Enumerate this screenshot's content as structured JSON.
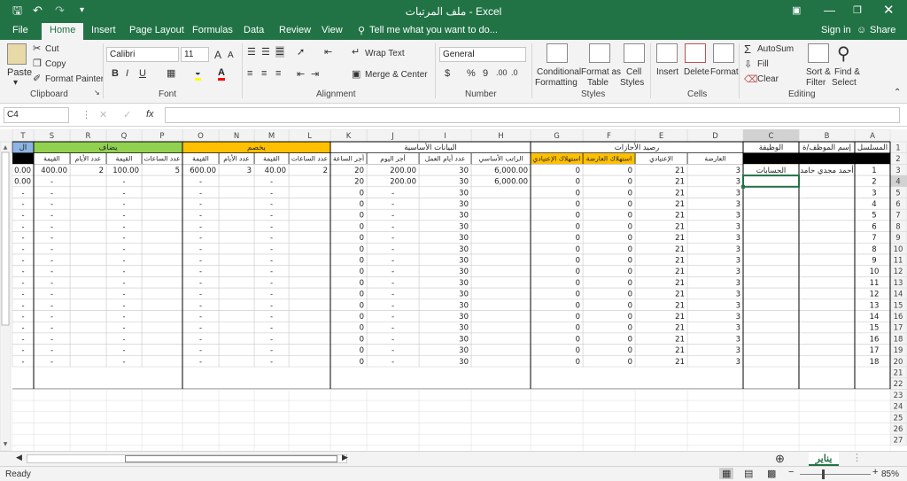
{
  "window": {
    "title": "ملف المرتبات - Excel"
  },
  "quick_access": {
    "save_icon": "save-icon",
    "undo_icon": "undo-icon",
    "redo_icon": "redo-icon"
  },
  "window_controls": {
    "minimize": "minimize-icon",
    "maximize": "restore-icon",
    "close": "close-icon"
  },
  "tabs": [
    "File",
    "Home",
    "Insert",
    "Page Layout",
    "Formulas",
    "Data",
    "Review",
    "View"
  ],
  "active_tab": "Home",
  "tell_me": "Tell me what you want to do...",
  "sign_in": "Sign in",
  "share": "Share",
  "ribbon": {
    "clipboard": {
      "paste": "Paste",
      "cut": "Cut",
      "copy": "Copy",
      "format_painter": "Format Painter",
      "label": "Clipboard"
    },
    "font": {
      "name": "Calibri",
      "size": "11",
      "bold": "B",
      "italic": "I",
      "underline": "U",
      "label": "Font"
    },
    "alignment": {
      "wrap": "Wrap Text",
      "merge": "Merge & Center",
      "label": "Alignment"
    },
    "number": {
      "format": "General",
      "currency": "$",
      "percent": "%",
      "comma": "9",
      "label": "Number"
    },
    "styles": {
      "conditional": "Conditional",
      "conditional2": "Formatting",
      "format_as": "Format as",
      "format_as2": "Table",
      "cell": "Cell",
      "cell2": "Styles",
      "label": "Styles"
    },
    "cells": {
      "insert": "Insert",
      "delete": "Delete",
      "format": "Format",
      "label": "Cells"
    },
    "editing": {
      "autosum": "AutoSum",
      "fill": "Fill",
      "clear": "Clear",
      "sort": "Sort &",
      "sort2": "Filter",
      "find": "Find &",
      "find2": "Select",
      "label": "Editing"
    }
  },
  "formula_bar": {
    "name_box": "C4",
    "fx": "fx",
    "content": ""
  },
  "accent": "#217346",
  "sheet": {
    "col_letters": [
      "A",
      "B",
      "C",
      "D",
      "E",
      "F",
      "G",
      "H",
      "I",
      "J",
      "K",
      "L",
      "M",
      "N",
      "O",
      "P",
      "Q",
      "R",
      "S",
      "T"
    ],
    "row_numbers": [
      "1",
      "2",
      "3",
      "4",
      "5",
      "6",
      "7",
      "8",
      "9",
      "10",
      "11",
      "12",
      "13",
      "14",
      "15",
      "16",
      "17",
      "18",
      "19",
      "20",
      "21",
      "22",
      "23",
      "24",
      "25",
      "26",
      "27"
    ],
    "row1": {
      "A": "المسلسل",
      "B": "إسم الموظف/ة",
      "C": "الوظيفة",
      "D_G": "رصيد الأجازات",
      "H_K": "البيانات الأساسية",
      "L_O": "يخصم",
      "P_S": "يضاف",
      "T": "ال"
    },
    "row2": {
      "D": "العارضة",
      "E": "الإعتيادي",
      "F": "استهلاك العارضة",
      "G": "استهلاك الإعتيادي",
      "H": "الراتب الأساسي",
      "I": "عدد أيام العمل",
      "J": "أجر اليوم",
      "K": "أجر الساعة",
      "L": "عدد الساعات",
      "M": "القيمة",
      "N": "عدد الأيام",
      "O": "القيمة",
      "P": "عدد الساعات",
      "Q": "القيمة",
      "R": "عدد الأيام",
      "S": "القيمة"
    },
    "row3": {
      "A": "1",
      "B": "أحمد مجدي حامد",
      "C": "الحسابات",
      "D": "3",
      "E": "21",
      "F": "0",
      "G": "0",
      "H": "6,000.00",
      "I": "30",
      "J": "200.00",
      "K": "20",
      "L": "2",
      "M": "40.00",
      "N": "3",
      "O": "600.00",
      "P": "5",
      "Q": "100.00",
      "R": "2",
      "S": "400.00",
      "T": "0.00"
    },
    "row4": {
      "A": "2",
      "D": "3",
      "E": "21",
      "F": "0",
      "G": "0",
      "H": "6,000.00",
      "I": "30",
      "J": "200.00",
      "K": "20",
      "M": "-",
      "O": "-",
      "Q": "-",
      "S": "-",
      "T": "0.00"
    },
    "data_rows": [
      "3",
      "4",
      "5",
      "6",
      "7",
      "8",
      "9",
      "10",
      "11",
      "12",
      "13",
      "14",
      "15",
      "16",
      "17",
      "18",
      "19",
      "20"
    ],
    "filler": {
      "D": "3",
      "E": "21",
      "F": "0",
      "G": "0",
      "I": "30",
      "J": "-",
      "K": "0",
      "M": "-",
      "O": "-",
      "Q": "-",
      "S": "-",
      "T": "-"
    },
    "colors": {
      "yellow": "#ffc000",
      "green": "#92d050",
      "blue": "#8db4e2",
      "black": "#000000"
    }
  },
  "sheet_tab": "يناير",
  "status": {
    "ready": "Ready",
    "zoom": "85%"
  }
}
